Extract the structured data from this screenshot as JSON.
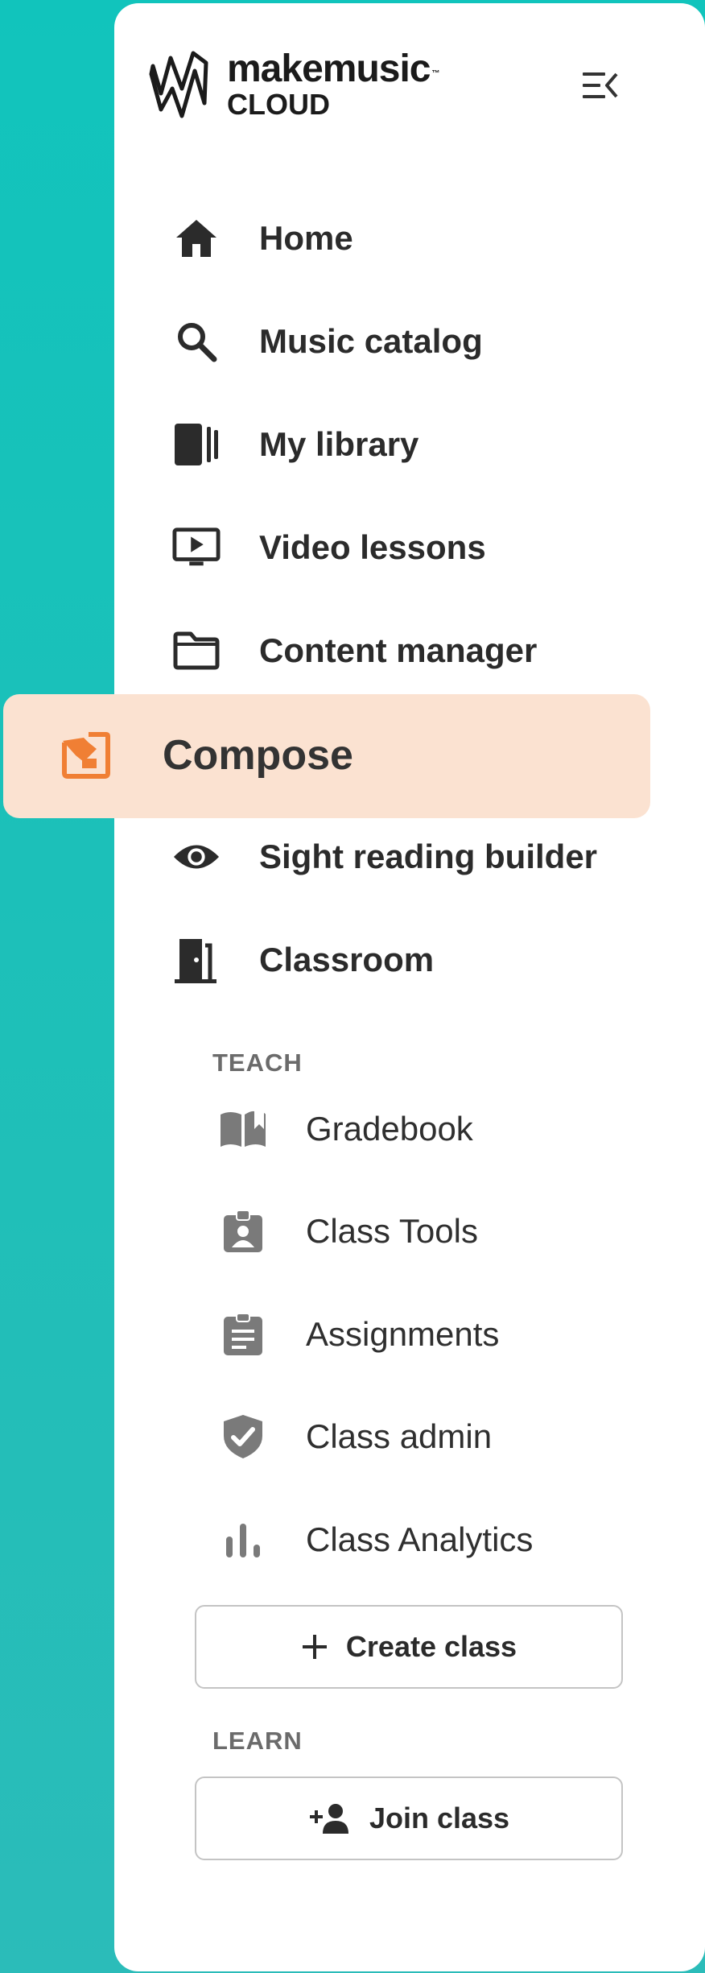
{
  "brand": {
    "line1": "makemusic",
    "trademark": "™",
    "line2": "CLOUD"
  },
  "nav": {
    "home": "Home",
    "music_catalog": "Music catalog",
    "my_library": "My library",
    "video_lessons": "Video lessons",
    "content_manager": "Content manager",
    "compose": "Compose",
    "sight_reading": "Sight reading builder",
    "classroom": "Classroom"
  },
  "teach": {
    "heading": "TEACH",
    "gradebook": "Gradebook",
    "class_tools": "Class Tools",
    "assignments": "Assignments",
    "class_admin": "Class admin",
    "class_analytics": "Class Analytics",
    "create_class": "Create class"
  },
  "learn": {
    "heading": "LEARN",
    "join_class": "Join class"
  },
  "colors": {
    "background_teal": "#11c4bc",
    "active_bg": "#fbe2d1",
    "active_icon": "#f07f34",
    "text_dark": "#2b2b2b",
    "icon_gray": "#7a7a7a"
  },
  "icons": {
    "logo": "makemusic-logo-icon",
    "collapse": "collapse-menu-icon",
    "home": "home-icon",
    "search": "search-icon",
    "library": "library-icon",
    "video": "video-lesson-icon",
    "folder": "folder-icon",
    "compose": "compose-icon",
    "eye": "eye-icon",
    "door": "door-icon",
    "book": "book-icon",
    "badge": "badge-icon",
    "clipboard": "clipboard-icon",
    "shield": "shield-check-icon",
    "analytics": "bar-chart-icon",
    "plus": "plus-icon",
    "add_person": "add-person-icon"
  }
}
